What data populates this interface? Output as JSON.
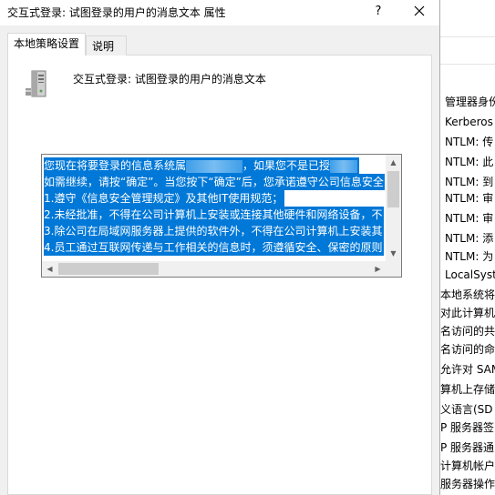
{
  "dialog": {
    "title": "交互式登录: 试图登录的用户的消息文本 属性",
    "help_label": "?",
    "tabs": [
      {
        "label": "本地策略设置"
      },
      {
        "label": "说明"
      }
    ],
    "policy_name": "交互式登录: 试图登录的用户的消息文本",
    "message_lines": [
      {
        "before": "您现在将要登录的信息系统属",
        "after": "，如果您不是已授"
      },
      {
        "before": "如需继续，请按“确定”。当您按下“确定”后，您承诺遵守公司信息安全",
        "after": ""
      },
      {
        "before": "1.遵守《信息安全管理规定》及其他IT使用规范；",
        "after": ""
      },
      {
        "before": "2.未经批准，不得在公司计算机上安装或连接其他硬件和网络设备，不",
        "after": ""
      },
      {
        "before": "3.除公司在局域网服务器上提供的软件外，不得在公司计算机上安装其",
        "after": ""
      },
      {
        "before": "4.员工通过互联网传递与工作相关的信息时，须遵循安全、保密的原则",
        "after": ""
      }
    ]
  },
  "background_window": {
    "rows": [
      "管理器身份",
      "Kerberos",
      "NTLM: 传",
      "NTLM: 此",
      "NTLM: 到",
      "NTLM: 审",
      "NTLM: 审",
      "NTLM: 添",
      "NTLM: 为",
      "LocalSyste",
      "本地系统将",
      "对此计算机",
      "名访问的共",
      "名访问的命",
      "允许对 SAM",
      "算机上存储",
      "义语言(SD",
      "P 服务器签",
      "P 服务器通",
      "计算机帐户",
      "服务器操作"
    ]
  },
  "colors": {
    "selection": "#0078d7",
    "dialog_bg": "#f0f0f0"
  }
}
